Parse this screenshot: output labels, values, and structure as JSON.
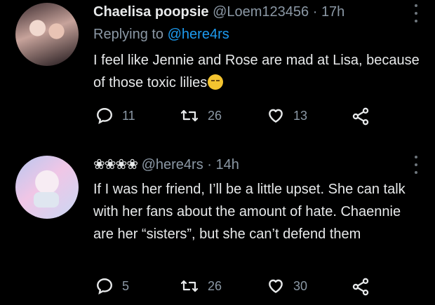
{
  "tweets": [
    {
      "name": "Chaelisa poopsie",
      "handle": "@Loem123456",
      "separator": "·",
      "time": "17h",
      "replying_prefix": "Replying to ",
      "replying_handle": "@here4rs",
      "text": "I feel like Jennie and Rose are mad at Lisa, because of those toxic lilies",
      "emoji": "pensive-face-emoji",
      "replies": "11",
      "retweets": "26",
      "likes": "13"
    },
    {
      "name": "❀❀❀❀",
      "handle": "@here4rs",
      "separator": "·",
      "time": "14h",
      "text": "If I was her friend, I’ll be a little upset. She can talk with her fans about the amount of hate. Chaennie are her “sisters”, but she can’t defend them",
      "replies": "5",
      "retweets": "26",
      "likes": "30"
    }
  ],
  "colors": {
    "background": "#000000",
    "text": "#e7e9ea",
    "muted": "#8b98a5",
    "link": "#1d9bf0"
  },
  "icons": [
    "reply-icon",
    "retweet-icon",
    "like-icon",
    "share-icon",
    "more-icon"
  ]
}
